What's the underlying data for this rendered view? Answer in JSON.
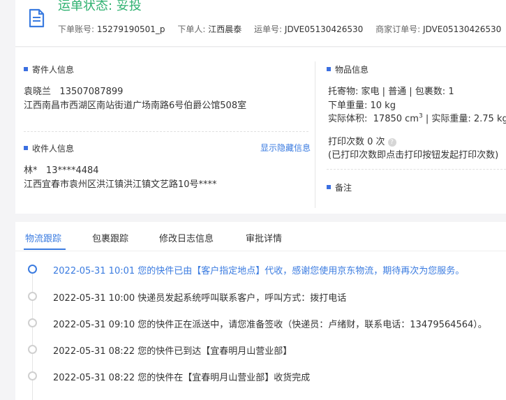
{
  "header": {
    "status": "运单状态: 妥投",
    "account_label": "下单账号:",
    "account_value": "15279190501_p",
    "orderer_label": "下单人:",
    "orderer_value": "江西晨泰",
    "waybill_label": "运单号:",
    "waybill_value": "JDVE05130426530",
    "merchant_label": "商家订单号:",
    "merchant_value": "JDVE05130426530"
  },
  "sender": {
    "title": "寄件人信息",
    "name": "袁晓兰",
    "phone": "13507087899",
    "address": "江西南昌市西湖区南站街道广场南路6号伯爵公馆508室"
  },
  "receiver": {
    "title": "收件人信息",
    "toggle_link": "显示隐藏信息",
    "name": "林*",
    "phone": "13****4484",
    "address": "江西宜春市袁州区洪江镇洪江镇文艺路10号****"
  },
  "goods": {
    "title": "物品信息",
    "line1": "托寄物:  家电 | 普通  |  包裹数:  1",
    "weight": "下单重量:   10 kg",
    "volume_label": "实际体积:",
    "volume_value": "17850 cm",
    "volume_exp": "3",
    "actual_weight": "|  实际重量:  2.75 kg",
    "print_count": "打印次数   0 次",
    "print_note": "(已打印次数即点击打印按钮发起打印次数)"
  },
  "notes": {
    "title": "备注"
  },
  "tabs": [
    "物流跟踪",
    "包裹跟踪",
    "修改日志信息",
    "审批详情"
  ],
  "events": [
    "2022-05-31 10:01  您的快件已由【客户指定地点】代收，感谢您使用京东物流，期待再次为您服务。",
    "2022-05-31 10:00  快递员发起系统呼叫联系客户，呼叫方式：拨打电话",
    "2022-05-31 09:10  您的快件正在派送中，请您准备签收（快递员：卢绪财，联系电话：13479564564）。",
    "2022-05-31 08:22  您的快件已到达【宜春明月山营业部】",
    "2022-05-31 08:22  您的快件在【宜春明月山营业部】收货完成"
  ],
  "colors": {
    "status_green": "#2fb170",
    "accent_blue": "#3a7be0"
  }
}
